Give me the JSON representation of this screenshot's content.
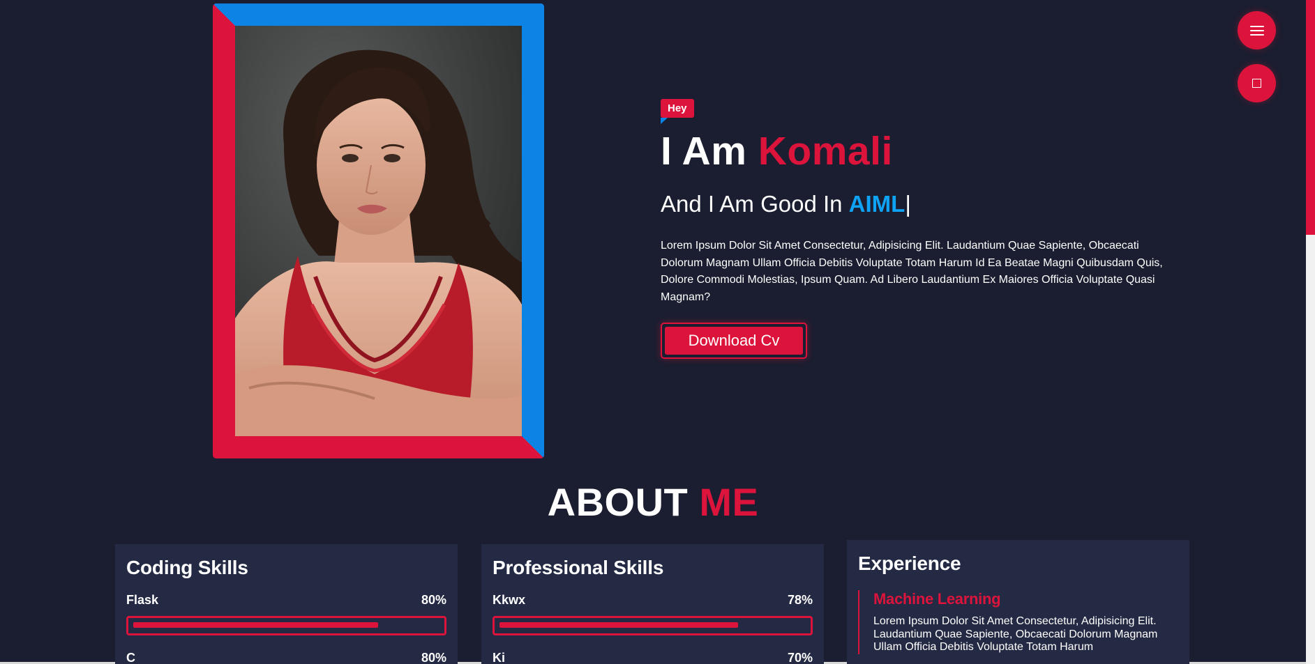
{
  "hero": {
    "badge": "Hey",
    "title_prefix": "I Am ",
    "title_name": "Komali",
    "subtitle_prefix": "And I Am Good In ",
    "subtitle_skill": "AIML",
    "subtitle_cursor": "|",
    "description": "Lorem Ipsum Dolor Sit Amet Consectetur, Adipisicing Elit. Laudantium Quae Sapiente, Obcaecati Dolorum Magnam Ullam Officia Debitis Voluptate Totam Harum Id Ea Beatae Magni Quibusdam Quis, Dolore Commodi Molestias, Ipsum Quam. Ad Libero Laudantium Ex Maiores Officia Voluptate Quasi Magnam?",
    "cv_button": "Download Cv"
  },
  "fab": {
    "menu_icon": "hamburger-menu-icon",
    "theme_icon": "square-icon"
  },
  "about": {
    "title_prefix": "ABOUT ",
    "title_accent": "ME"
  },
  "coding": {
    "title": "Coding Skills",
    "skills": [
      {
        "name": "Flask",
        "percent_label": "80%",
        "percent": 80
      }
    ],
    "next_partial": {
      "name": "C",
      "percent_label": "80%"
    }
  },
  "professional": {
    "title": "Professional Skills",
    "skills": [
      {
        "name": "Kkwx",
        "percent_label": "78%",
        "percent": 78
      }
    ],
    "next_partial": {
      "name": "Ki",
      "percent_label": "70%"
    }
  },
  "experience": {
    "title": "Experience",
    "items": [
      {
        "role": "Machine Learning",
        "description": "Lorem Ipsum Dolor Sit Amet Consectetur, Adipisicing Elit. Laudantium Quae Sapiente, Obcaecati Dolorum Magnam Ullam Officia Debitis Voluptate Totam Harum"
      }
    ]
  },
  "colors": {
    "background": "#1a1e30",
    "card": "#242a44",
    "accent_red": "#dc143c",
    "accent_blue": "#0b84e6",
    "skill_blue": "#0fa3f5"
  }
}
